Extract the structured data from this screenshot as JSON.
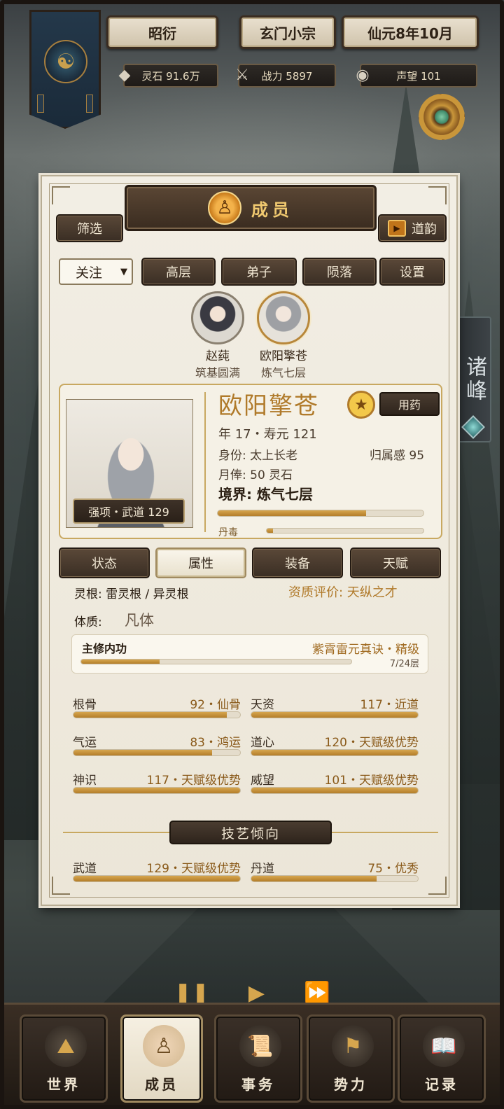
{
  "header": {
    "player_name": "昭衍",
    "sect_name": "玄门小宗",
    "date": "仙元8年10月",
    "spirit_stone": "灵石 91.6万",
    "combat_power": "战力 5897",
    "prestige": "声望 101"
  },
  "side_tab": "诸峰",
  "panel": {
    "title": "成员",
    "filter_button": "筛选",
    "daoyun_button": "道韵",
    "dropdown_value": "关注",
    "tabs": [
      "高层",
      "弟子",
      "陨落",
      "设置"
    ]
  },
  "favorites": [
    {
      "name": "赵莼",
      "realm": "筑基圆满"
    },
    {
      "name": "欧阳擎苍",
      "realm": "炼气七层"
    }
  ],
  "character": {
    "name": "欧阳擎苍",
    "use_medicine": "用药",
    "strength": "强项・武道 129",
    "age_line": "年 17・寿元 121",
    "identity": "身份: 太上长老",
    "belonging": "归属感 95",
    "salary": "月俸: 50 灵石",
    "realm": "境界: 炼气七层",
    "realm_progress": 0.72,
    "dandu_label": "丹毒",
    "dandu_progress": 0.04
  },
  "detail_tabs": [
    "状态",
    "属性",
    "装备",
    "天赋"
  ],
  "attributes": {
    "spirit_root": "灵根: 雷灵根 / 异灵根",
    "aptitude": "资质评价: 天纵之才",
    "constitution_label": "体质:",
    "constitution_value": "凡体",
    "main_art_label": "主修内功",
    "main_art_value": "紫霄雷元真诀・精级",
    "main_art_level": "7/24层",
    "main_art_progress": 0.29,
    "stats": [
      {
        "name": "根骨",
        "value": "92・仙骨",
        "progress": 0.92
      },
      {
        "name": "天资",
        "value": "117・近道",
        "progress": 1.0
      },
      {
        "name": "气运",
        "value": "83・鸿运",
        "progress": 0.83
      },
      {
        "name": "道心",
        "value": "120・天赋级优势",
        "progress": 1.0
      },
      {
        "name": "神识",
        "value": "117・天赋级优势",
        "progress": 1.0
      },
      {
        "name": "威望",
        "value": "101・天赋级优势",
        "progress": 1.0
      }
    ]
  },
  "skills": {
    "header": "技艺倾向",
    "items": [
      {
        "name": "武道",
        "value": "129・天赋级优势",
        "progress": 1.0
      },
      {
        "name": "丹道",
        "value": "75・优秀",
        "progress": 0.75
      }
    ]
  },
  "nav": [
    "世界",
    "成员",
    "事务",
    "势力",
    "记录"
  ],
  "colors": {
    "accent_gold": "#b07a2a",
    "bar_fill": "#c8943c",
    "wood": "#3a2e24"
  }
}
